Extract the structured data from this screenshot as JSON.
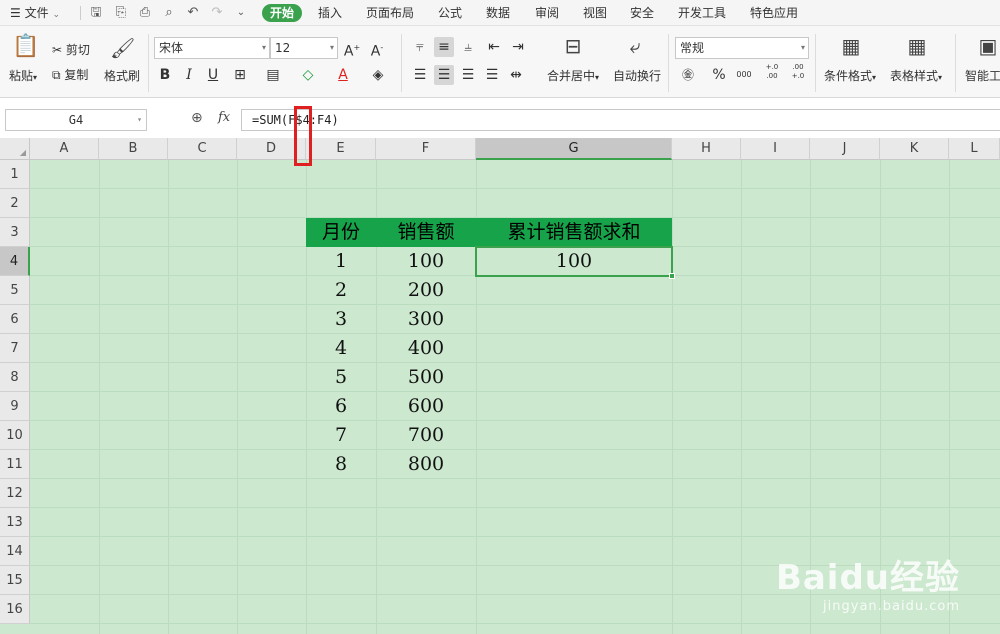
{
  "menu": {
    "file_label": "文件",
    "tabs": [
      "开始",
      "插入",
      "页面布局",
      "公式",
      "数据",
      "审阅",
      "视图",
      "安全",
      "开发工具",
      "特色应用"
    ],
    "active_tab": "开始"
  },
  "ribbon": {
    "paste": "粘贴",
    "cut": "剪切",
    "copy": "复制",
    "format_painter": "格式刷",
    "font_name": "宋体",
    "font_size": "12",
    "bold": "B",
    "italic": "I",
    "underline": "U",
    "merge_center": "合并居中",
    "wrap_text": "自动换行",
    "number_format": "常规",
    "percent": "%",
    "thousands": "000",
    "inc_decimal": "+.0 .00",
    "dec_decimal": ".00 +.0",
    "conditional_format": "条件格式",
    "table_style": "表格样式",
    "smart_tools": "智能工"
  },
  "formula_bar": {
    "name_box": "G4",
    "fx_label": "fx",
    "formula": "=SUM(F$4:F4)"
  },
  "sheet": {
    "columns": [
      "A",
      "B",
      "C",
      "D",
      "E",
      "F",
      "G",
      "H",
      "I",
      "J",
      "K",
      "L"
    ],
    "rows": [
      "1",
      "2",
      "3",
      "4",
      "5",
      "6",
      "7",
      "8",
      "9",
      "10",
      "11",
      "12",
      "13",
      "14",
      "15",
      "16"
    ],
    "selected_column": "G",
    "selected_row": "4",
    "headers": {
      "month": "月份",
      "sales": "销售额",
      "cumulative": "累计销售额求和"
    },
    "data": [
      {
        "month": "1",
        "sales": "100",
        "cumulative": "100"
      },
      {
        "month": "2",
        "sales": "200",
        "cumulative": ""
      },
      {
        "month": "3",
        "sales": "300",
        "cumulative": ""
      },
      {
        "month": "4",
        "sales": "400",
        "cumulative": ""
      },
      {
        "month": "5",
        "sales": "500",
        "cumulative": ""
      },
      {
        "month": "6",
        "sales": "600",
        "cumulative": ""
      },
      {
        "month": "7",
        "sales": "700",
        "cumulative": ""
      },
      {
        "month": "8",
        "sales": "800",
        "cumulative": ""
      }
    ],
    "header_fill": "#16a34a",
    "sheet_bg": "#cce8cf",
    "accent": "#3aa14d"
  },
  "watermark": {
    "brand": "Baidu经验",
    "url": "jingyan.baidu.com"
  }
}
